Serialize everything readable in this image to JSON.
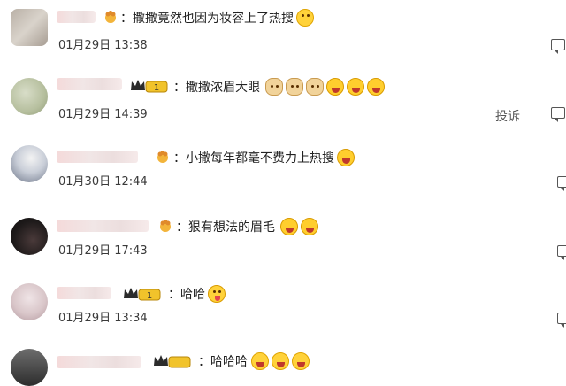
{
  "comments": [
    {
      "separator": "：",
      "text": "撒撒竟然也因为妆容上了热搜",
      "time": "01月29日 13:38"
    },
    {
      "separator": "：",
      "text": "撒撒浓眉大眼",
      "time": "01月29日 14:39",
      "report": "投诉"
    },
    {
      "separator": "：",
      "text": "小撒每年都毫不费力上热搜",
      "time": "01月30日 12:44"
    },
    {
      "separator": "：",
      "text": "狠有想法的眉毛",
      "time": "01月29日 17:43"
    },
    {
      "separator": "：",
      "text": "哈哈",
      "time": "01月29日 13:34"
    },
    {
      "separator": "：",
      "text": "哈哈哈",
      "time": ""
    }
  ],
  "badges": {
    "vip_level": "1"
  },
  "icons": {
    "reply": "comment-reply-icon",
    "crown": "crown-badge-icon",
    "emoji": [
      "smile",
      "doge",
      "laugh",
      "tongue",
      "grin"
    ]
  },
  "colors": {
    "gold": "#e8b300",
    "dark": "#333333",
    "text": "#222222"
  }
}
